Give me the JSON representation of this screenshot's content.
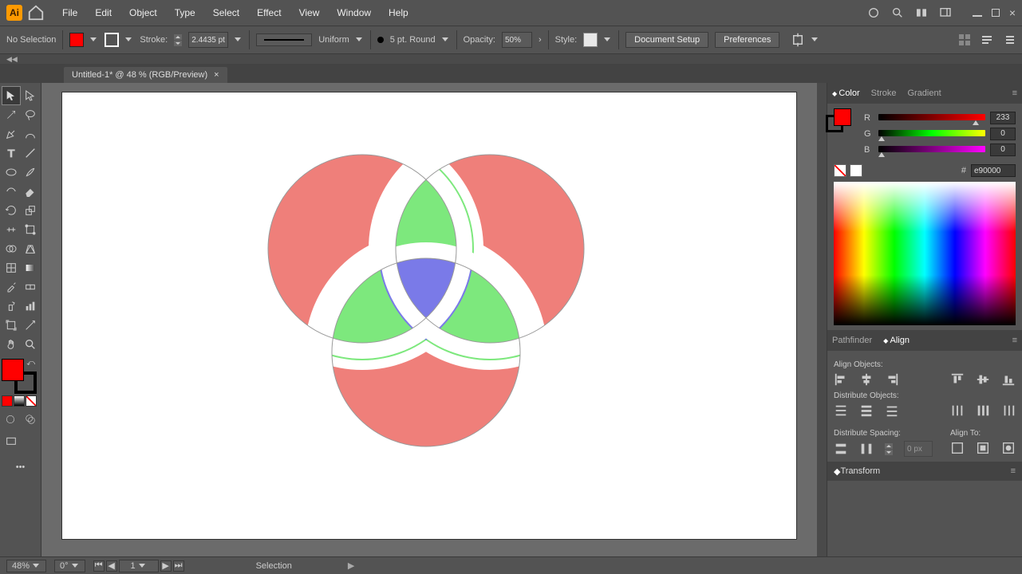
{
  "menubar": {
    "items": [
      "File",
      "Edit",
      "Object",
      "Type",
      "Select",
      "Effect",
      "View",
      "Window",
      "Help"
    ]
  },
  "optbar": {
    "selection": "No Selection",
    "stroke_label": "Stroke:",
    "stroke_val": "2.4435 pt",
    "profile_label": "Uniform",
    "brush_label": "5 pt. Round",
    "opacity_label": "Opacity:",
    "opacity_val": "50%",
    "style_label": "Style:",
    "doc_setup": "Document Setup",
    "prefs": "Preferences"
  },
  "doctab": {
    "title": "Untitled-1* @ 48 % (RGB/Preview)",
    "close": "×"
  },
  "panels": {
    "color": {
      "tabs": [
        "Color",
        "Stroke",
        "Gradient"
      ],
      "r_label": "R",
      "g_label": "G",
      "b_label": "B",
      "r_val": "233",
      "g_val": "0",
      "b_val": "0",
      "hex_hash": "#",
      "hex": "e90000"
    },
    "align": {
      "tabs": [
        "Pathfinder",
        "Align"
      ],
      "sect1": "Align Objects:",
      "sect2": "Distribute Objects:",
      "sect3": "Distribute Spacing:",
      "alignto": "Align To:",
      "spval": "0 px"
    },
    "transform": "Transform"
  },
  "status": {
    "zoom": "48%",
    "rotate": "0°",
    "page": "1",
    "tool": "Selection"
  }
}
